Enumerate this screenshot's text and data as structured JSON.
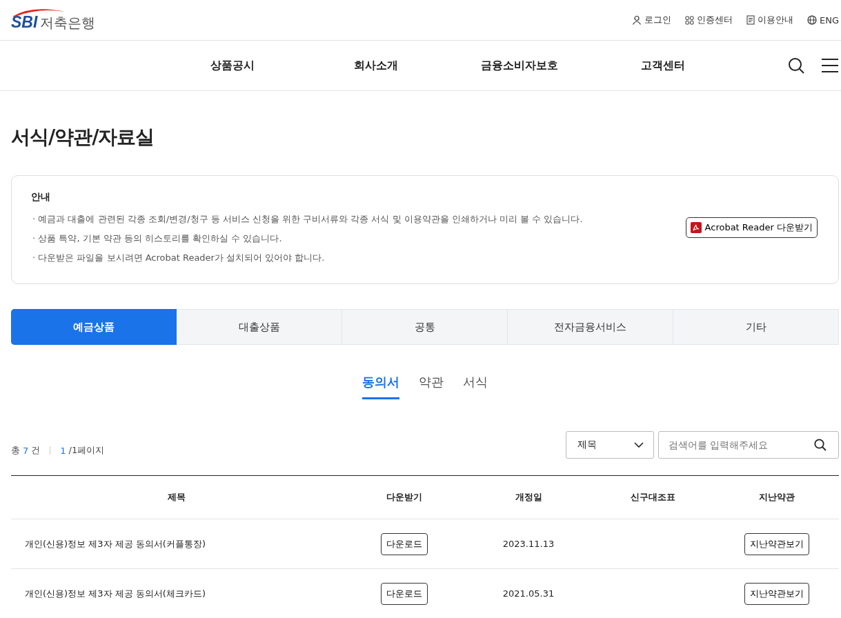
{
  "logo": {
    "mark": "SBI",
    "name": "저축은행"
  },
  "utility_links": [
    {
      "kind": "person",
      "label": "로그인"
    },
    {
      "kind": "grid",
      "label": "인증센터"
    },
    {
      "kind": "doc",
      "label": "이용안내"
    },
    {
      "kind": "globe",
      "label": "ENG"
    }
  ],
  "nav": [
    "상품공시",
    "회사소개",
    "금융소비자보호",
    "고객센터"
  ],
  "page_title": "서식/약관/자료실",
  "notice": {
    "title": "안내",
    "lines": [
      "· 예금과 대출에 관련된 각종 조회/변경/청구 등 서비스 신청을 위한 구비서류와 각종 서식 및 이용약관을 인쇄하거나 미리 볼 수 있습니다.",
      "· 상품 특약, 기본 약관 등의 히스토리를 확인하실 수 있습니다.",
      "· 다운받은 파일을 보시려면 Acrobat Reader가 설치되어 있어야 합니다."
    ],
    "button": "Acrobat Reader 다운받기"
  },
  "tabs": [
    {
      "label": "예금상품",
      "selected": true
    },
    {
      "label": "대출상품",
      "selected": false
    },
    {
      "label": "공통",
      "selected": false
    },
    {
      "label": "전자금융서비스",
      "selected": false
    },
    {
      "label": "기타",
      "selected": false
    }
  ],
  "subtabs": [
    {
      "label": "동의서",
      "selected": true
    },
    {
      "label": "약관",
      "selected": false
    },
    {
      "label": "서식",
      "selected": false
    }
  ],
  "count": {
    "prefix": "총",
    "number": "7",
    "suffix": "건",
    "page": "1",
    "page_suffix": "/1페이지"
  },
  "search": {
    "filter": "제목",
    "placeholder": "검색어를 입력해주세요"
  },
  "table": {
    "columns": [
      "제목",
      "다운받기",
      "개정일",
      "신구대조표",
      "지난약관"
    ],
    "rows": [
      {
        "title": "개인(신용)정보 제3자 제공 동의서(커플통장)",
        "download": "다운로드",
        "date": "2023.11.13",
        "history": "지난약관보기"
      },
      {
        "title": "개인(신용)정보 제3자 제공 동의서(체크카드)",
        "download": "다운로드",
        "date": "2021.05.31",
        "history": "지난약관보기"
      }
    ]
  }
}
